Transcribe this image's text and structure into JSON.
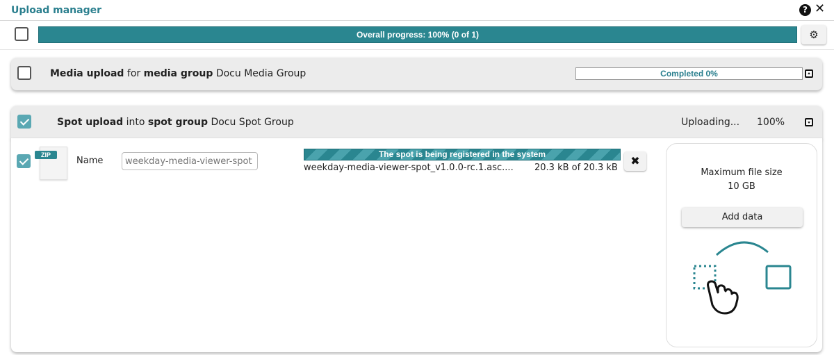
{
  "window": {
    "title": "Upload manager"
  },
  "toolbar": {
    "overall_progress_text": "Overall progress: 100% (0 of 1)",
    "overall_progress_percent": 100
  },
  "media_group": {
    "kind_label": "Media upload",
    "for_text": "for",
    "target_label": "media group",
    "group_name": "Docu Media Group",
    "status_text": "Completed 0%",
    "progress_percent": 0
  },
  "spot_group": {
    "kind_label": "Spot upload",
    "into_text": "into",
    "target_label": "spot group",
    "group_name": "Docu Spot Group",
    "status_text": "Uploading...",
    "percent_text": "100%"
  },
  "file": {
    "type_badge": "ZIP",
    "name_label": "Name",
    "name_placeholder": "weekday-media-viewer-spot",
    "status_text": "The spot is being registered in the system",
    "file_name": "weekday-media-viewer-spot_v1.0.0-rc.1.asc....",
    "size_text": "20.3 kB of 20.3 kB"
  },
  "drop_zone": {
    "max_label": "Maximum file size",
    "max_value": "10 GB",
    "add_button": "Add data"
  },
  "icons": {
    "help": "question-circle-icon",
    "close": "close-icon",
    "settings": "gear-icon",
    "cancel": "x-icon",
    "collapse": "caret-square-up-icon",
    "expand": "caret-square-down-icon",
    "drag": "drag-and-drop-hand-icon"
  },
  "colors": {
    "accent": "#2a8690",
    "title": "#2a7f8e",
    "checked": "#5aa8b3"
  }
}
